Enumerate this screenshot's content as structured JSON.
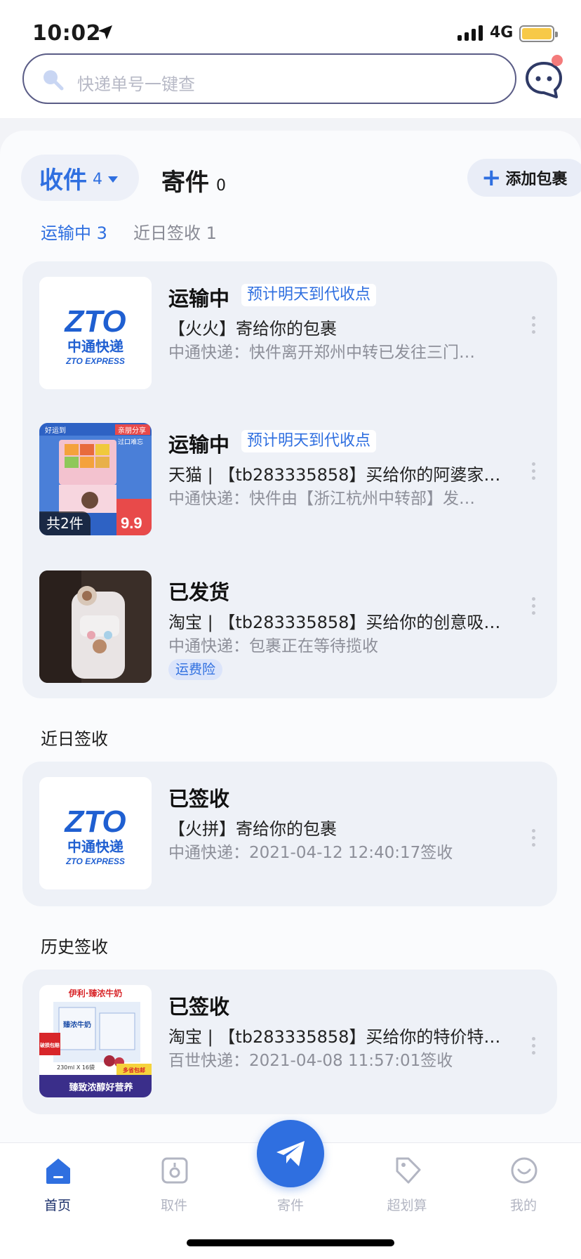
{
  "status_bar": {
    "time": "10:02",
    "network": "4G"
  },
  "search": {
    "placeholder": "快递单号一键查"
  },
  "tabs": {
    "receive": {
      "label": "收件",
      "count": "4"
    },
    "send": {
      "label": "寄件",
      "count": "0"
    },
    "add_button": "添加包裹"
  },
  "subtabs": {
    "in_transit": "运输中 3",
    "recent": "近日签收 1"
  },
  "in_transit_packages": [
    {
      "status": "运输中",
      "eta": "预计明天到代收点",
      "title": "【火火】寄给你的包裹",
      "detail": "中通快递：快件离开郑州中转已发往三门…",
      "thumb": "zto-logo"
    },
    {
      "status": "运输中",
      "eta": "预计明天到代收点",
      "title": "天猫 | 【tb283335858】买给你的阿婆家…",
      "detail": "中通快递：快件由【浙江杭州中转部】发…",
      "thumb": "snack-box",
      "count_badge": "共2件"
    },
    {
      "status": "已发货",
      "title": "淘宝 | 【tb283335858】买给你的创意吸…",
      "detail": "中通快递：包裹正在等待揽收",
      "thumb": "water-bottle",
      "tag": "运费险"
    }
  ],
  "recent_section_title": "近日签收",
  "recent_packages": [
    {
      "status": "已签收",
      "title": "【火拼】寄给你的包裹",
      "detail": "中通快递：2021-04-12 12:40:17签收",
      "thumb": "zto-logo"
    }
  ],
  "history_section_title": "历史签收",
  "history_packages": [
    {
      "status": "已签收",
      "title": "淘宝 | 【tb283335858】买给你的特价特…",
      "detail": "百世快递：2021-04-08 11:57:01签收",
      "thumb": "milk-box"
    }
  ],
  "zto_logo": {
    "mark": "ZTO",
    "cn": "中通快递",
    "en": "ZTO EXPRESS"
  },
  "snack_thumb": {
    "top_left": "好运到",
    "top_right": "亲朋分享",
    "sub": "过口难忘",
    "promo": "9.9"
  },
  "milk_thumb": {
    "brand": "伊利·臻浓牛奶",
    "pack": "臻浓牛奶",
    "badge": "破损包赔",
    "spec": "230ml X 16袋",
    "slogan": "臻致浓醇好营养",
    "tag": "多省包邮"
  },
  "nav": [
    {
      "label": "首页",
      "icon": "home-icon",
      "active": true
    },
    {
      "label": "取件",
      "icon": "pickup-icon",
      "active": false
    },
    {
      "label": "寄件",
      "icon": "send-plane-icon",
      "active": false
    },
    {
      "label": "超划算",
      "icon": "tag-icon",
      "active": false
    },
    {
      "label": "我的",
      "icon": "profile-icon",
      "active": false
    }
  ],
  "colors": {
    "accent": "#2f6fe0",
    "card": "#eef1f7",
    "muted": "#8d8f99"
  }
}
